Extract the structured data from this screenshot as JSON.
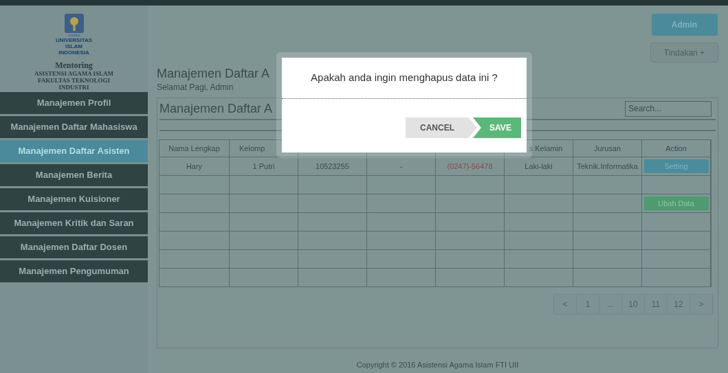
{
  "sidebar": {
    "logo_lines": [
      "UNIVERSITAS",
      "ISLAM",
      "INDONESIA"
    ],
    "app_title": "Mentoring",
    "subtitle_lines": [
      "ASISTENSI AGAMA ISLAM",
      "FAKULTAS TEKNOLOGI",
      "INDUSTRI"
    ],
    "items": [
      {
        "label": "Manajemen Profil",
        "selected": false
      },
      {
        "label": "Manajemen Daftar Mahasiswa",
        "selected": false
      },
      {
        "label": "Manajemen Daftar Asisten",
        "selected": true
      },
      {
        "label": "Manajemen Berita",
        "selected": false
      },
      {
        "label": "Manajemen Kuisioner",
        "selected": false
      },
      {
        "label": "Manajemen Kritik dan Saran",
        "selected": false
      },
      {
        "label": "Manajemen Daftar Dosen",
        "selected": false
      },
      {
        "label": "Manajemen Pengumuman",
        "selected": false
      }
    ]
  },
  "header": {
    "title": "Manajemen Daftar A",
    "greeting": "Selamat Pagi, Admin",
    "user_button": "Admin",
    "actions_button": "Tindakan +"
  },
  "card": {
    "title": "Manajemen Daftar A",
    "search": {
      "placeholder": "Search..."
    }
  },
  "table": {
    "columns": [
      {
        "label": "Nama Lengkap"
      },
      {
        "label": "Kelomp"
      },
      {},
      {},
      {},
      {
        "label": "s Kelamin"
      },
      {
        "label": "Jurusan"
      },
      {
        "label": "Action"
      }
    ],
    "rows": [
      {
        "cells": [
          {
            "text": "Hary"
          },
          {
            "text": "1 Putri"
          },
          {
            "text": "10523255"
          },
          {
            "text": "-"
          },
          {
            "text": "(0247)-56478",
            "kind": "phone"
          },
          {
            "text": "Laki-laki"
          },
          {
            "text": "Teknik.Informatika"
          }
        ],
        "action": {
          "label": "Setting",
          "kind": "info"
        }
      },
      {},
      {
        "action": {
          "label": "Ubah Data",
          "kind": "success"
        }
      },
      {},
      {},
      {},
      {}
    ]
  },
  "pagination": [
    "<",
    "1",
    "...",
    "10",
    "11",
    "12",
    ">"
  ],
  "footer": "Copyright © 2016 Asistensi Agama Islam FTI UII",
  "dialog": {
    "message": "Apakah anda ingin menghapus data ini ?",
    "cancel": "CANCEL",
    "confirm": "SAVE"
  }
}
